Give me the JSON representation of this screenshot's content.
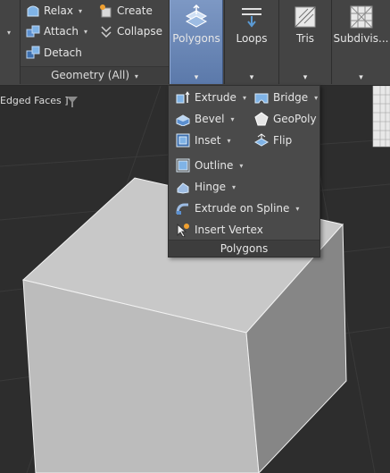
{
  "geometry_panel": {
    "relax_label": "Relax",
    "attach_label": "Attach",
    "detach_label": "Detach",
    "create_label": "Create",
    "collapse_label": "Collapse",
    "footer_label": "Geometry (All)"
  },
  "big_buttons": {
    "polygons_label": "Polygons",
    "loops_label": "Loops",
    "tris_label": "Tris",
    "subdivide_label": "Subdivis..."
  },
  "viewport": {
    "label": "Edged Faces ]"
  },
  "polygons_menu": {
    "extrude_label": "Extrude",
    "bridge_label": "Bridge",
    "bevel_label": "Bevel",
    "geopoly_label": "GeoPoly",
    "inset_label": "Inset",
    "flip_label": "Flip",
    "outline_label": "Outline",
    "hinge_label": "Hinge",
    "extrude_spline_label": "Extrude   on Spline",
    "insert_vertex_label": "Insert Vertex",
    "footer_label": "Polygons"
  },
  "colors": {
    "ribbon_bg": "#444444",
    "active_button": "#6a87b8",
    "viewport_bg": "#2d2d2d",
    "cube_top": "#c9c9c9",
    "cube_front": "#bdbdbd",
    "cube_side": "#878787"
  }
}
